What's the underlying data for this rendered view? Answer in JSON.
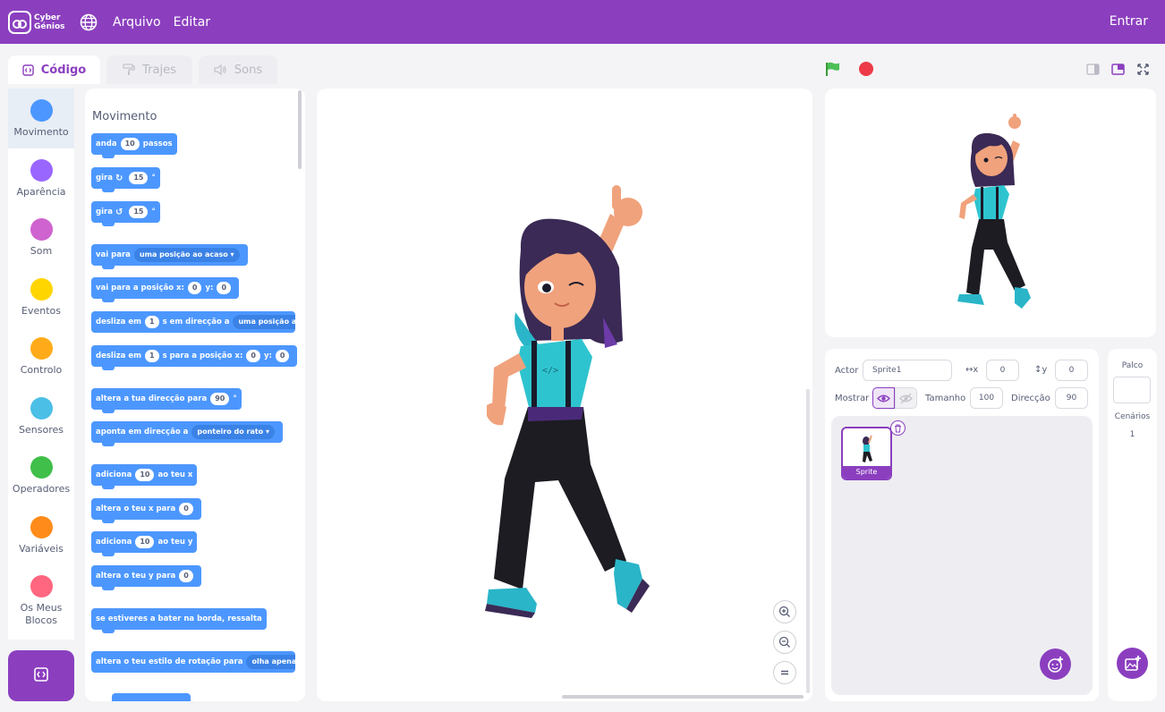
{
  "brand": {
    "line1": "Cyber",
    "line2": "Génios"
  },
  "menu": {
    "file": "Arquivo",
    "edit": "Editar",
    "sign_in": "Entrar"
  },
  "tabs": {
    "code": "Código",
    "costumes": "Trajes",
    "sounds": "Sons"
  },
  "colors": {
    "header": "#8b3fbf",
    "block_motion": "#4c97ff",
    "accent": "#8b3fbf"
  },
  "categories": [
    {
      "label": "Movimento",
      "color": "#4c97ff"
    },
    {
      "label": "Aparência",
      "color": "#9966ff"
    },
    {
      "label": "Som",
      "color": "#cf63cf"
    },
    {
      "label": "Eventos",
      "color": "#ffd500"
    },
    {
      "label": "Controlo",
      "color": "#ffab19"
    },
    {
      "label": "Sensores",
      "color": "#4cbfe6"
    },
    {
      "label": "Operadores",
      "color": "#40bf4a"
    },
    {
      "label": "Variáveis",
      "color": "#ff8c1a"
    },
    {
      "label": "Os Meus Blocos",
      "color": "#ff6680"
    }
  ],
  "palette": {
    "title": "Movimento",
    "b_move": {
      "a": "anda",
      "n": "10",
      "b": "passos"
    },
    "b_turn_r": {
      "a": "gira",
      "n": "15",
      "b": "°"
    },
    "b_turn_l": {
      "a": "gira",
      "n": "15",
      "b": "°"
    },
    "b_goto": {
      "a": "vai para",
      "dd": "uma posição ao acaso"
    },
    "b_gotoxy": {
      "a": "vai para a posição x:",
      "x": "0",
      "b": "y:",
      "y": "0"
    },
    "b_glide": {
      "a": "desliza em",
      "n": "1",
      "b": "s em direcção a",
      "dd": "uma posição ao"
    },
    "b_glidexy": {
      "a": "desliza em",
      "n": "1",
      "b": "s para a posição x:",
      "x": "0",
      "c": "y:",
      "y": "0"
    },
    "b_point": {
      "a": "altera a tua direcção para",
      "n": "90",
      "b": "°"
    },
    "b_pointto": {
      "a": "aponta em direcção a",
      "dd": "ponteiro do rato"
    },
    "b_changex": {
      "a": "adiciona",
      "n": "10",
      "b": "ao teu x"
    },
    "b_setx": {
      "a": "altera o teu x para",
      "n": "0"
    },
    "b_changey": {
      "a": "adiciona",
      "n": "10",
      "b": "ao teu y"
    },
    "b_sety": {
      "a": "altera o teu y para",
      "n": "0"
    },
    "b_bounce": {
      "a": "se estiveres a bater na borda, ressalta"
    },
    "b_rotstyle": {
      "a": "altera o teu estilo de rotação para",
      "dd": "olha apenas par"
    }
  },
  "sprite_info": {
    "actor_label": "Actor",
    "actor_name": "Sprite1",
    "x_label": "x",
    "x": "0",
    "y_label": "y",
    "y": "0",
    "show_label": "Mostrar",
    "size_label": "Tamanho",
    "size": "100",
    "direction_label": "Direcção",
    "direction": "90"
  },
  "sprite_tile": {
    "name": "Sprite"
  },
  "stage_panel": {
    "title": "Palco",
    "backdrops_label": "Cenários",
    "backdrops_count": "1"
  }
}
